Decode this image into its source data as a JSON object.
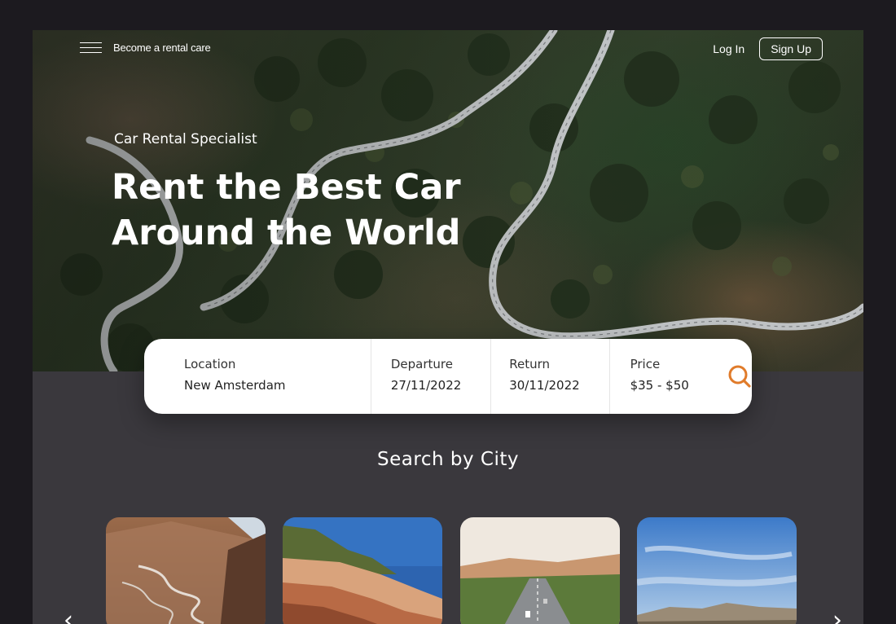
{
  "nav": {
    "menu_icon": "hamburger-menu-icon",
    "become_label": "Become a rental care",
    "login_label": "Log In",
    "signup_label": "Sign Up"
  },
  "hero": {
    "eyebrow": "Car Rental Specialist",
    "headline_line1": "Rent the Best Car",
    "headline_line2": "Around the World"
  },
  "search": {
    "fields": [
      {
        "label": "Location",
        "value": "New Amsterdam"
      },
      {
        "label": "Departure",
        "value": "27/11/2022"
      },
      {
        "label": "Return",
        "value": "30/11/2022"
      },
      {
        "label": "Price",
        "value": "$35 - $50"
      }
    ],
    "button_icon": "search-icon",
    "accent_color": "#e07b2a"
  },
  "cities": {
    "title": "Search by City",
    "cards": [
      {
        "image": "mountain-serpentine-road"
      },
      {
        "image": "red-rock-canyon"
      },
      {
        "image": "highway-through-valley"
      },
      {
        "image": "mesa-blue-sky"
      }
    ],
    "prev_icon": "chevron-left-icon",
    "next_icon": "chevron-right-icon"
  }
}
